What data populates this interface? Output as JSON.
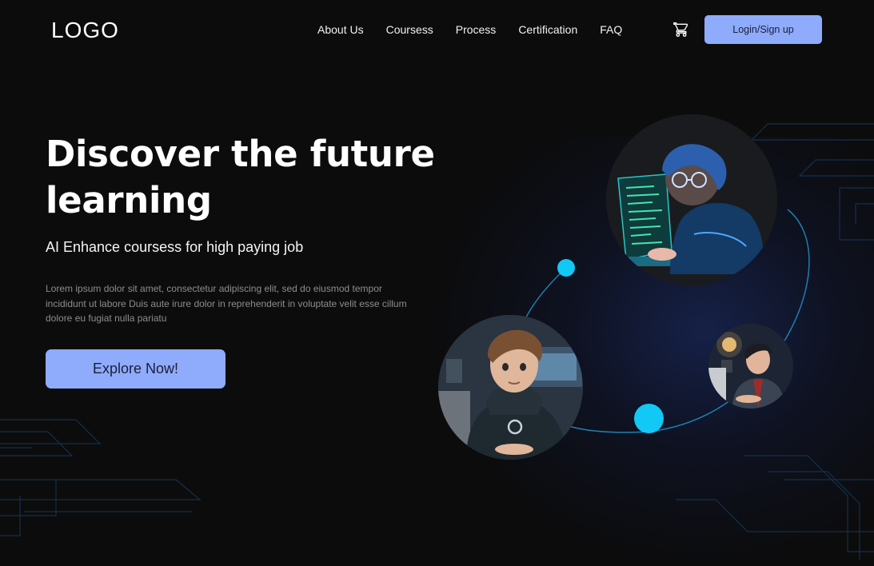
{
  "header": {
    "logo": "LOGO",
    "nav": [
      "About Us",
      "Coursess",
      "Process",
      "Certification",
      "FAQ"
    ],
    "cart_icon": "cart-icon",
    "login_label": "Login/Sign up"
  },
  "hero": {
    "title": "Discover the future learning",
    "subtitle": "AI Enhance coursess for high paying job",
    "description": "Lorem ipsum dolor sit amet, consectetur adipiscing elit, sed do eiusmod tempor incididunt ut labore Duis aute irure dolor in reprehenderit in voluptate velit esse cillum dolore eu fugiat nulla pariatu",
    "cta_label": "Explore Now!"
  },
  "colors": {
    "background": "#0c0c0d",
    "accent": "#8fabfb",
    "dot": "#12c8f5",
    "orbit": "#1e7fb0"
  }
}
